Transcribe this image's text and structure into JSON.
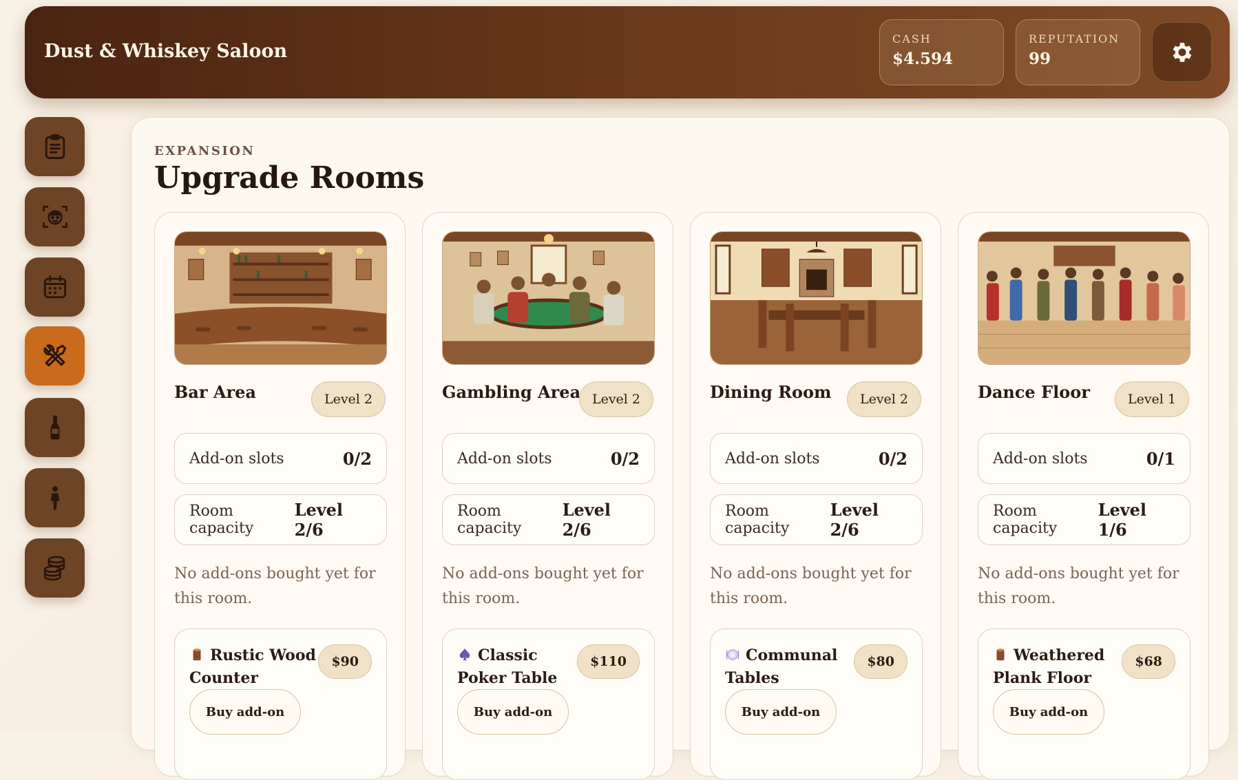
{
  "header": {
    "title": "Dust & Whiskey Saloon",
    "cash_label": "CASH",
    "cash_value": "$4.594",
    "reputation_label": "REPUTATION",
    "reputation_value": "99",
    "settings_icon": "gear-icon"
  },
  "sidebar": {
    "items": [
      {
        "icon": "clipboard-icon",
        "active": false
      },
      {
        "icon": "staff-face-icon",
        "active": false
      },
      {
        "icon": "calendar-icon",
        "active": false
      },
      {
        "icon": "tools-icon",
        "active": true
      },
      {
        "icon": "bottle-icon",
        "active": false
      },
      {
        "icon": "person-icon",
        "active": false
      },
      {
        "icon": "coins-icon",
        "active": false
      }
    ]
  },
  "main": {
    "kicker": "EXPANSION",
    "title": "Upgrade Rooms",
    "slots_label": "Add-on slots",
    "capacity_label": "Room capacity",
    "empty_text": "No add-ons bought yet for this room.",
    "buy_label": "Buy add-on",
    "rooms": [
      {
        "name": "Bar Area",
        "level": "Level 2",
        "slots": "0/2",
        "capacity": "Level 2/6",
        "addon_name": "Rustic Wood Counter",
        "addon_price": "$90",
        "addon_icon": "wood-log-icon"
      },
      {
        "name": "Gambling Area",
        "level": "Level 2",
        "slots": "0/2",
        "capacity": "Level 2/6",
        "addon_name": "Classic Poker Table",
        "addon_price": "$110",
        "addon_icon": "spade-icon"
      },
      {
        "name": "Dining Room",
        "level": "Level 2",
        "slots": "0/2",
        "capacity": "Level 2/6",
        "addon_name": "Communal Tables",
        "addon_price": "$80",
        "addon_icon": "plate-icon"
      },
      {
        "name": "Dance Floor",
        "level": "Level 1",
        "slots": "0/1",
        "capacity": "Level 1/6",
        "addon_name": "Weathered Plank Floor",
        "addon_price": "$68",
        "addon_icon": "wood-log-icon"
      }
    ]
  },
  "colors": {
    "accent": "#c96a1d",
    "header_dark": "#4a2412",
    "nav_button": "#6e4427",
    "panel": "#fdf8f0"
  }
}
